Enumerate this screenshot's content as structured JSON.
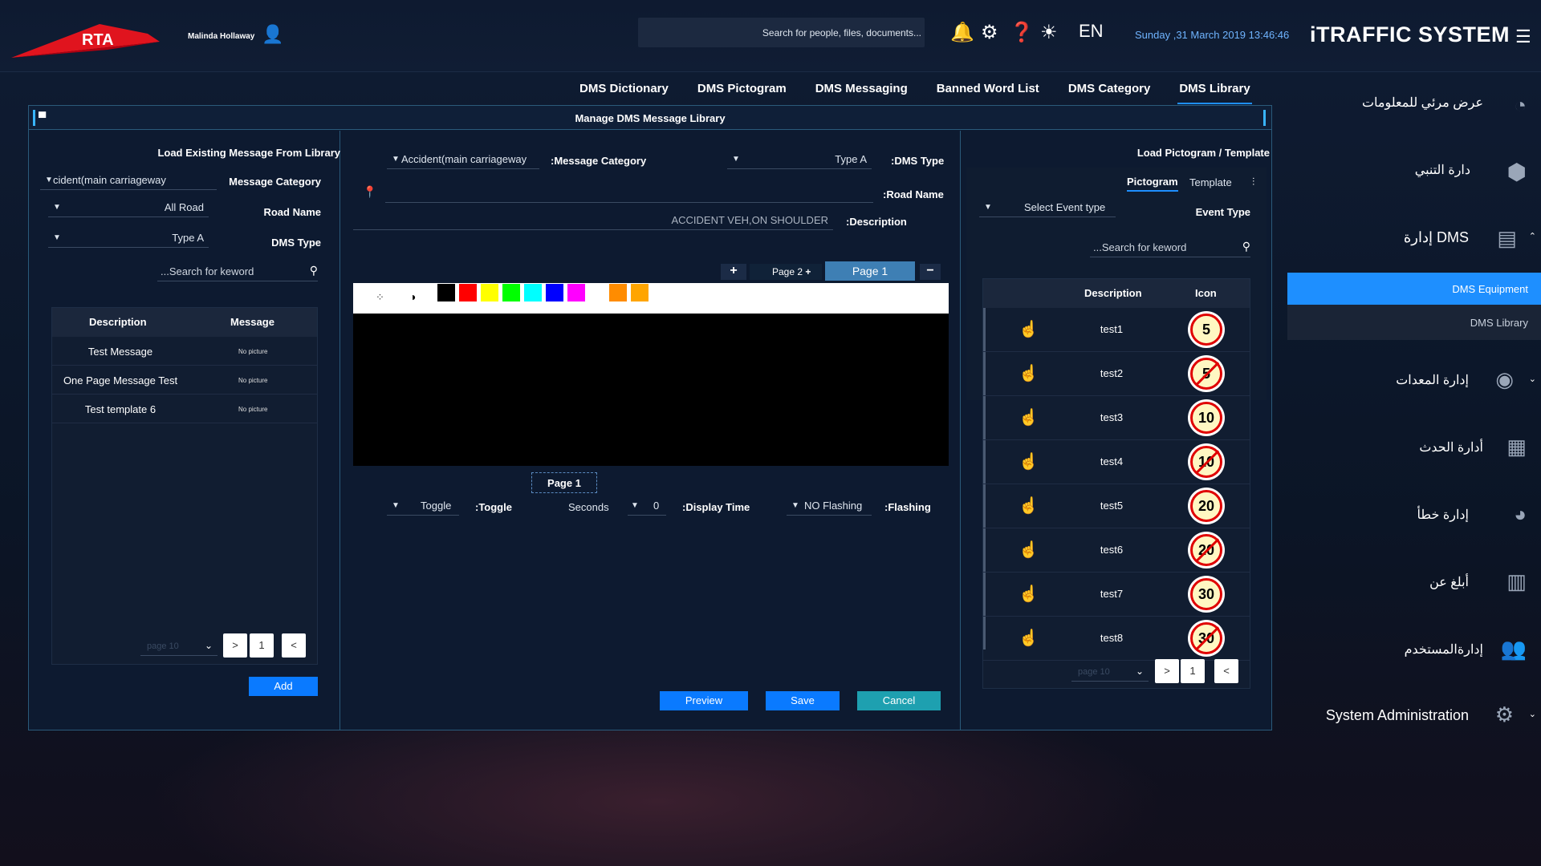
{
  "header": {
    "logo": "RTA",
    "user": "Malinda Hollaway",
    "search_placeholder": "Search for people, files, documents...",
    "lang": "EN",
    "datetime": "Sunday ,31 March 2019 13:46:46",
    "app_title": "iTRAFFIC SYSTEM"
  },
  "tabs": [
    "DMS Dictionary",
    "DMS Pictogram",
    "DMS Messaging",
    "Banned Word List",
    "DMS Category",
    "DMS Library"
  ],
  "panel": {
    "title": "Manage DMS Message Library"
  },
  "left": {
    "title": "Load Existing Message From Library",
    "category_label": "Message Category",
    "category_value": "cident(main carriageway",
    "road_label": "Road Name",
    "road_value": "All Road",
    "dmstype_label": "DMS Type",
    "dmstype_value": "Type A",
    "search_placeholder": "...Search for keword",
    "col_desc": "Description",
    "col_msg": "Message",
    "rows": [
      {
        "desc": "Test Message",
        "msg": "No picture"
      },
      {
        "desc": "One Page Message Test",
        "msg": "No picture"
      },
      {
        "desc": "Test template 6",
        "msg": "No picture"
      }
    ],
    "page_select": "page 10",
    "page_num": "1",
    "add": "Add"
  },
  "middle": {
    "msg_cat_label": ":Message Category",
    "msg_cat_value": "Accident(main carriageway",
    "dms_type_label": ":DMS Type",
    "dms_type_value": "Type A",
    "road_label": ":Road Name",
    "desc_label": ":Description",
    "desc_value": "ACCIDENT VEH,ON SHOULDER",
    "page2": "Page 2",
    "page1": "Page 1",
    "page_indicator": "Page 1",
    "toggle_label": ":Toggle",
    "toggle_value": "Toggle",
    "display_label": ":Display Time",
    "display_value": "0",
    "display_unit": "Seconds",
    "flash_label": ":Flashing",
    "flash_value": "NO Flashing",
    "preview": "Preview",
    "save": "Save",
    "cancel": "Cancel",
    "colors": [
      "#000000",
      "#ff0000",
      "#ffff00",
      "#00ff00",
      "#00ffff",
      "#0000ff",
      "#ff00ff",
      "#ff8c00",
      "#ffa500"
    ]
  },
  "right": {
    "title": "Load Pictogram / Template",
    "tab_pictogram": "Pictogram",
    "tab_template": "Template",
    "event_label": "Event Type",
    "event_value": "Select Event type",
    "search_placeholder": "...Search for keword",
    "col_desc": "Description",
    "col_icon": "Icon",
    "rows": [
      {
        "desc": "test1",
        "icon": "5",
        "strike": false
      },
      {
        "desc": "test2",
        "icon": "5",
        "strike": true
      },
      {
        "desc": "test3",
        "icon": "10",
        "strike": false
      },
      {
        "desc": "test4",
        "icon": "10",
        "strike": true
      },
      {
        "desc": "test5",
        "icon": "20",
        "strike": false
      },
      {
        "desc": "test6",
        "icon": "20",
        "strike": true
      },
      {
        "desc": "test7",
        "icon": "30",
        "strike": false
      },
      {
        "desc": "test8",
        "icon": "30",
        "strike": true
      }
    ],
    "page_select": "page 10",
    "page_num": "1"
  },
  "sidebar": {
    "items": [
      "عرض مرئي للمعلومات",
      "دارة التنبي",
      "إدارة DMS",
      "DMS Equipment",
      "DMS Library",
      "إدارة المعدات",
      "أدارة الحدث",
      "إدارة خطأ",
      "أبلغ عن",
      "إدارةالمستخدم",
      "System Administration"
    ]
  }
}
